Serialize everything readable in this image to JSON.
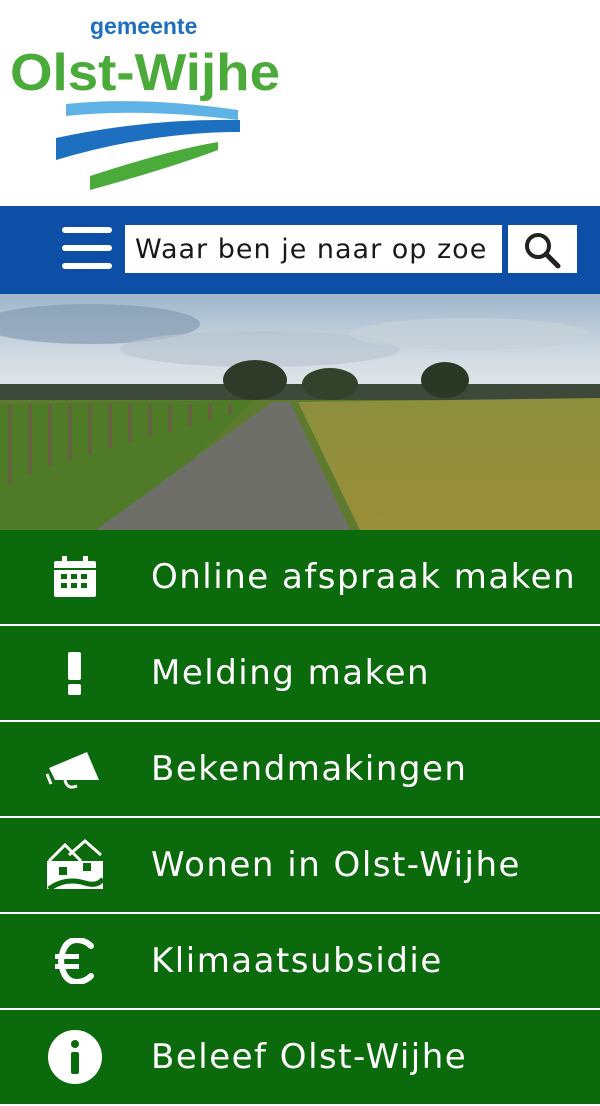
{
  "logo": {
    "top_text": "gemeente",
    "main_text": "Olst-Wijhe",
    "colors": {
      "green": "#4aaa3a",
      "blue": "#1d6fbf",
      "light_blue": "#5fb2e6"
    }
  },
  "search": {
    "placeholder": "Waar ben je naar op zoe",
    "menu_icon": "hamburger-icon",
    "search_icon": "magnifier-icon"
  },
  "hero": {
    "description": "landscape-photo"
  },
  "menu": {
    "items": [
      {
        "label": "Online afspraak maken",
        "icon": "calendar-icon"
      },
      {
        "label": "Melding maken",
        "icon": "exclamation-icon"
      },
      {
        "label": "Bekendmakingen",
        "icon": "megaphone-icon"
      },
      {
        "label": "Wonen in Olst-Wijhe",
        "icon": "houses-icon"
      },
      {
        "label": "Klimaatsubsidie",
        "icon": "euro-icon"
      },
      {
        "label": "Beleef Olst-Wijhe",
        "icon": "info-icon"
      }
    ]
  },
  "colors": {
    "header_blue": "#0d4fa7",
    "menu_green": "#0b6a0b",
    "text_white": "#ffffff"
  }
}
